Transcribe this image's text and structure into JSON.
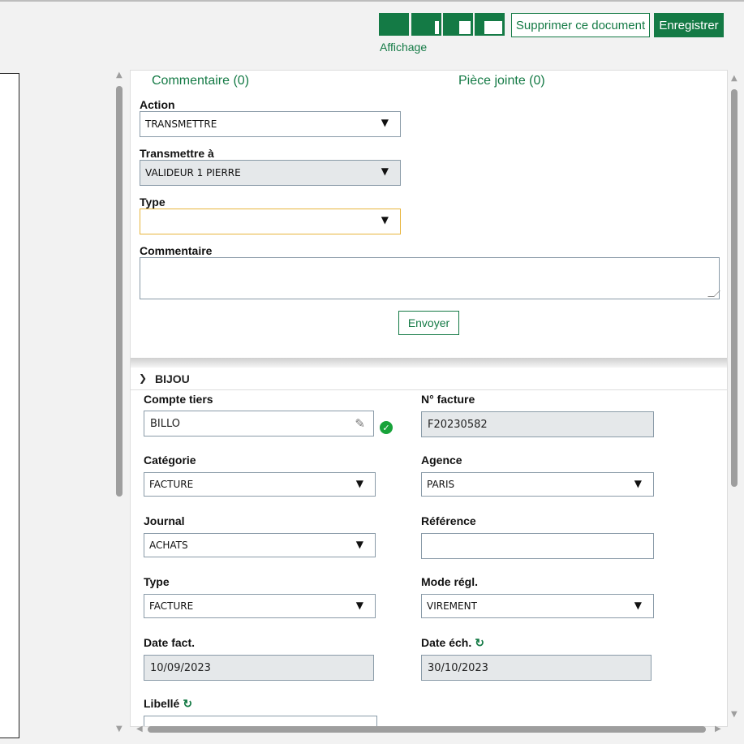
{
  "toolbar": {
    "view_icons": [
      "layout-full-icon",
      "layout-right-bar-icon",
      "layout-split-icon",
      "layout-half-icon"
    ],
    "delete_label": "Supprimer ce document",
    "save_label": "Enregistrer",
    "view_label": "Affichage"
  },
  "tabs": {
    "comment": "Commentaire (0)",
    "attachment": "Pièce jointe (0)"
  },
  "workflow": {
    "action_label": "Action",
    "action_value": "TRANSMETTRE",
    "transmit_label": "Transmettre à",
    "transmit_value": "VALIDEUR 1 PIERRE",
    "type_label": "Type",
    "type_value": "",
    "comment_label": "Commentaire",
    "comment_value": "",
    "send_label": "Envoyer"
  },
  "section": {
    "title": "BIJOU",
    "fields": {
      "compte_tiers_label": "Compte tiers",
      "compte_tiers_value": "BILLO",
      "num_facture_label": "N° facture",
      "num_facture_value": "F20230582",
      "categorie_label": "Catégorie",
      "categorie_value": "FACTURE",
      "agence_label": "Agence",
      "agence_value": "PARIS",
      "journal_label": "Journal",
      "journal_value": "ACHATS",
      "reference_label": "Référence",
      "reference_value": "",
      "type_label": "Type",
      "type_value": "FACTURE",
      "mode_regl_label": "Mode régl.",
      "mode_regl_value": "VIREMENT",
      "date_fact_label": "Date fact.",
      "date_fact_value": "10/09/2023",
      "date_ech_label": "Date éch.",
      "date_ech_value": "30/10/2023",
      "libelle_label": "Libellé"
    }
  },
  "colors": {
    "accent": "#147a45",
    "focus": "#e8b53c",
    "valid": "#18a33a",
    "readonly_bg": "#e5e8ea"
  }
}
